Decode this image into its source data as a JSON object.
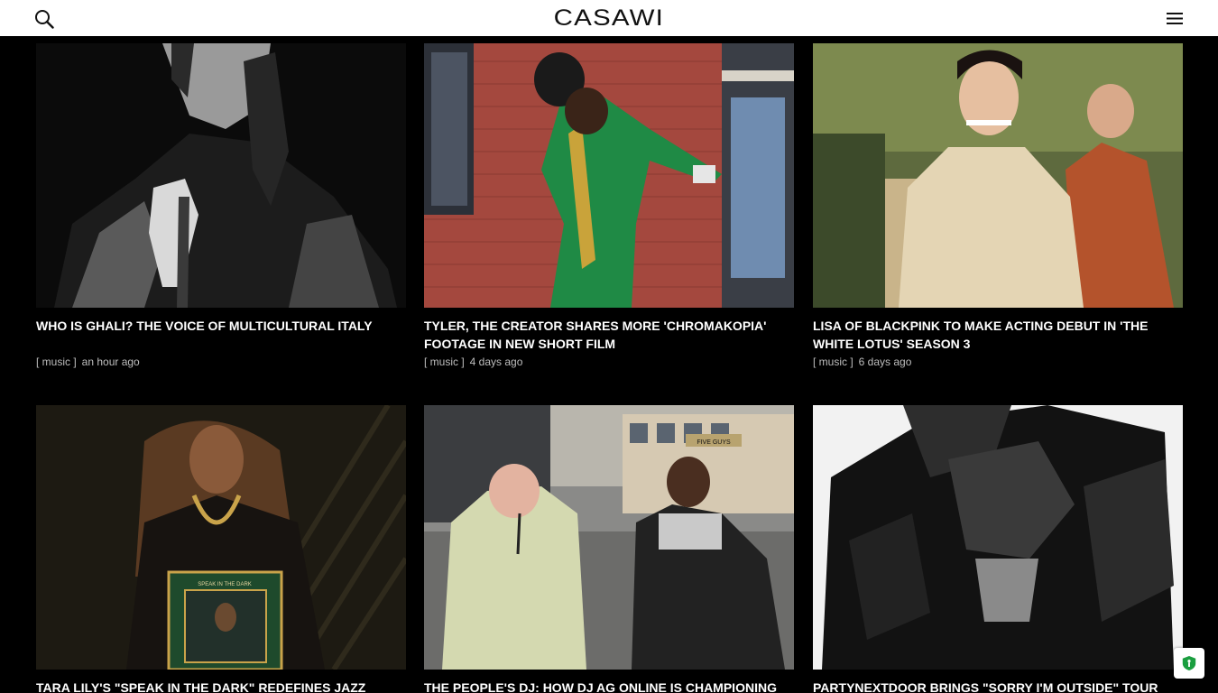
{
  "header": {
    "logo": "CASAWI",
    "search_icon": "search-icon",
    "menu_icon": "hamburger-menu-icon"
  },
  "articles": [
    {
      "title": "WHO IS GHALI? THE VOICE OF MULTICULTURAL ITALY",
      "category": "[ music ]",
      "time": "an hour ago"
    },
    {
      "title": "TYLER, THE CREATOR SHARES MORE 'CHROMAKOPIA' FOOTAGE IN NEW SHORT FILM",
      "category": "[ music ]",
      "time": "4 days ago"
    },
    {
      "title": "LISA OF BLACKPINK TO MAKE ACTING DEBUT IN 'THE WHITE LOTUS' SEASON 3",
      "category": "[ music ]",
      "time": "6 days ago"
    },
    {
      "title": "TARA LILY'S \"SPEAK IN THE DARK\" REDEFINES JAZZ FOR",
      "category": "",
      "time": ""
    },
    {
      "title": "THE PEOPLE'S DJ: HOW DJ AG ONLINE IS CHAMPIONING",
      "category": "",
      "time": ""
    },
    {
      "title": "PARTYNEXTDOOR BRINGS \"SORRY I'M OUTSIDE\" TOUR TO",
      "category": "",
      "time": ""
    }
  ],
  "album_cover_text": "SPEAK IN THE DARK",
  "street_sign_text": "FIVE GUYS",
  "floating_button": {
    "icon": "privacy-shield-icon",
    "color": "#1a9e3f"
  }
}
